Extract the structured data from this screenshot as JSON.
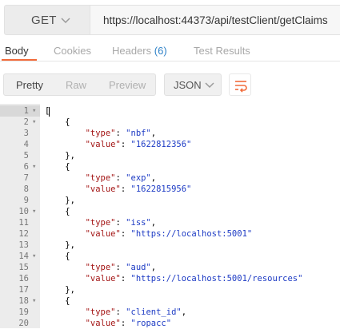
{
  "request": {
    "method": "GET",
    "url": "https://localhost:44373/api/testClient/getClaims"
  },
  "tabs": [
    {
      "label": "Body",
      "active": true
    },
    {
      "label": "Cookies",
      "active": false
    },
    {
      "label": "Headers",
      "count": "(6)",
      "active": false
    },
    {
      "label": "Test Results",
      "active": false
    }
  ],
  "view_modes": [
    "Pretty",
    "Raw",
    "Preview"
  ],
  "format": "JSON",
  "icons": {
    "method_dropdown": "chevron-down-icon",
    "format_dropdown": "chevron-down-icon",
    "wrap": "wrap-lines-icon",
    "fold": "fold-arrow-icon"
  },
  "colors": {
    "accent": "#f26b3a",
    "json_key": "#a31515",
    "json_string": "#1c3ac4",
    "count": "#2f82c8"
  },
  "code_lines": [
    {
      "n": "1",
      "fold": true,
      "text": "["
    },
    {
      "n": "2",
      "fold": true,
      "text": "    {"
    },
    {
      "n": "3",
      "fold": false,
      "key": "type",
      "value": "nbf",
      "indent": "        ",
      "trail": ","
    },
    {
      "n": "4",
      "fold": false,
      "key": "value",
      "value": "1622812356",
      "indent": "        ",
      "trail": ""
    },
    {
      "n": "5",
      "fold": false,
      "text": "    },"
    },
    {
      "n": "6",
      "fold": true,
      "text": "    {"
    },
    {
      "n": "7",
      "fold": false,
      "key": "type",
      "value": "exp",
      "indent": "        ",
      "trail": ","
    },
    {
      "n": "8",
      "fold": false,
      "key": "value",
      "value": "1622815956",
      "indent": "        ",
      "trail": ""
    },
    {
      "n": "9",
      "fold": false,
      "text": "    },"
    },
    {
      "n": "10",
      "fold": true,
      "text": "    {"
    },
    {
      "n": "11",
      "fold": false,
      "key": "type",
      "value": "iss",
      "indent": "        ",
      "trail": ","
    },
    {
      "n": "12",
      "fold": false,
      "key": "value",
      "value": "https://localhost:5001",
      "indent": "        ",
      "trail": ""
    },
    {
      "n": "13",
      "fold": false,
      "text": "    },"
    },
    {
      "n": "14",
      "fold": true,
      "text": "    {"
    },
    {
      "n": "15",
      "fold": false,
      "key": "type",
      "value": "aud",
      "indent": "        ",
      "trail": ","
    },
    {
      "n": "16",
      "fold": false,
      "key": "value",
      "value": "https://localhost:5001/resources",
      "indent": "        ",
      "trail": ""
    },
    {
      "n": "17",
      "fold": false,
      "text": "    },"
    },
    {
      "n": "18",
      "fold": true,
      "text": "    {"
    },
    {
      "n": "19",
      "fold": false,
      "key": "type",
      "value": "client_id",
      "indent": "        ",
      "trail": ","
    },
    {
      "n": "20",
      "fold": false,
      "key": "value",
      "value": "ropacc",
      "indent": "        ",
      "trail": ""
    }
  ]
}
